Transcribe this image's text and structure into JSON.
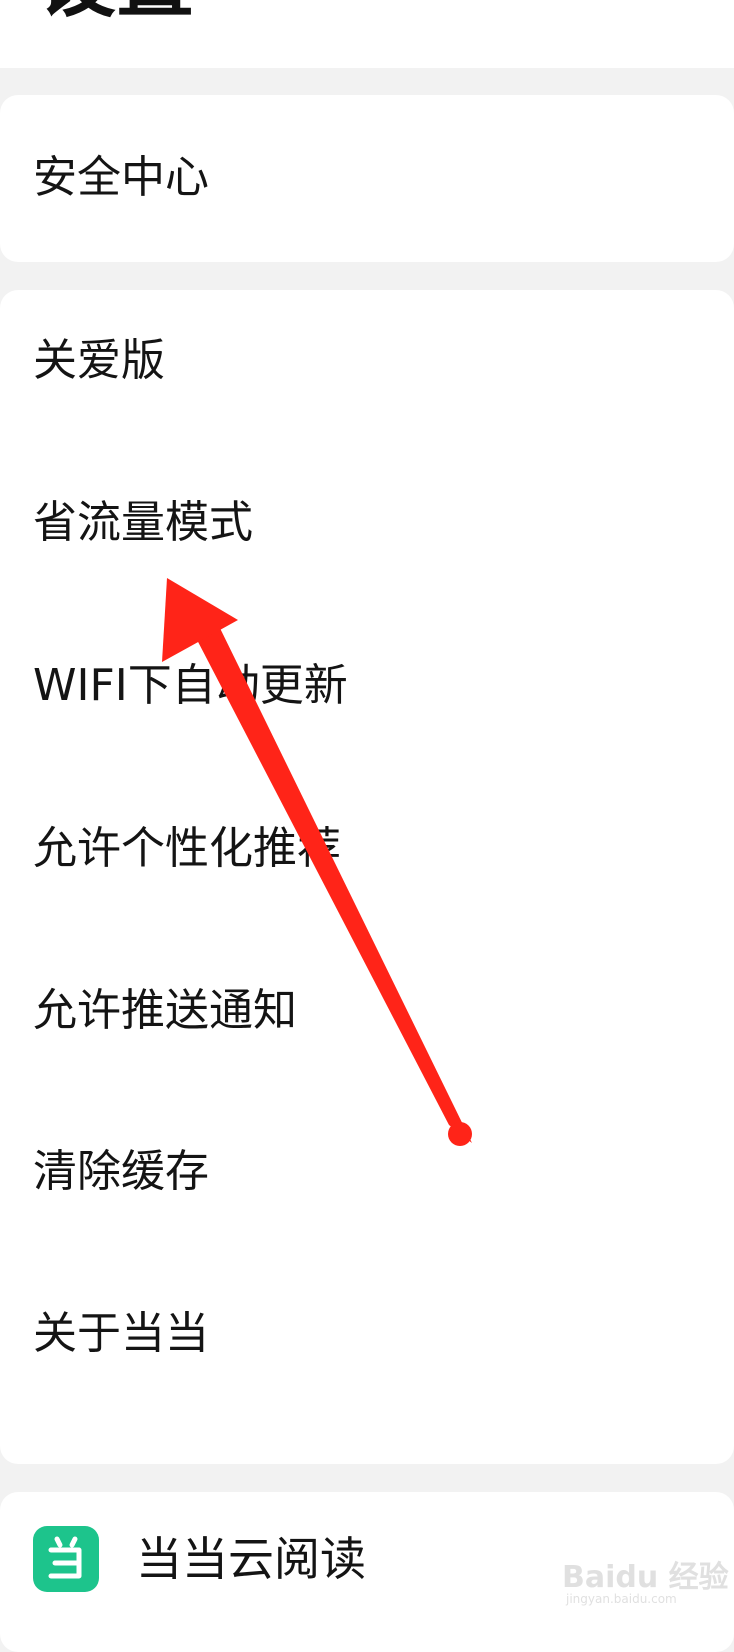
{
  "header": {
    "title": "设置"
  },
  "card1": {
    "items": [
      {
        "label": "安全中心"
      }
    ]
  },
  "card2": {
    "items": [
      {
        "label": "关爱版"
      },
      {
        "label": "省流量模式"
      },
      {
        "label": "WIFI下自动更新"
      },
      {
        "label": "允许个性化推荐"
      },
      {
        "label": "允许推送通知"
      },
      {
        "label": "清除缓存"
      },
      {
        "label": "关于当当"
      }
    ]
  },
  "card3": {
    "app": {
      "label": "当当云阅读",
      "icon": "dangdang-app-icon",
      "icon_color": "#1dc48c"
    }
  },
  "watermark": {
    "text": "Baidu 经验",
    "sub": "jingyan.baidu.com"
  },
  "annotation": {
    "arrow_color": "#ff2418"
  }
}
